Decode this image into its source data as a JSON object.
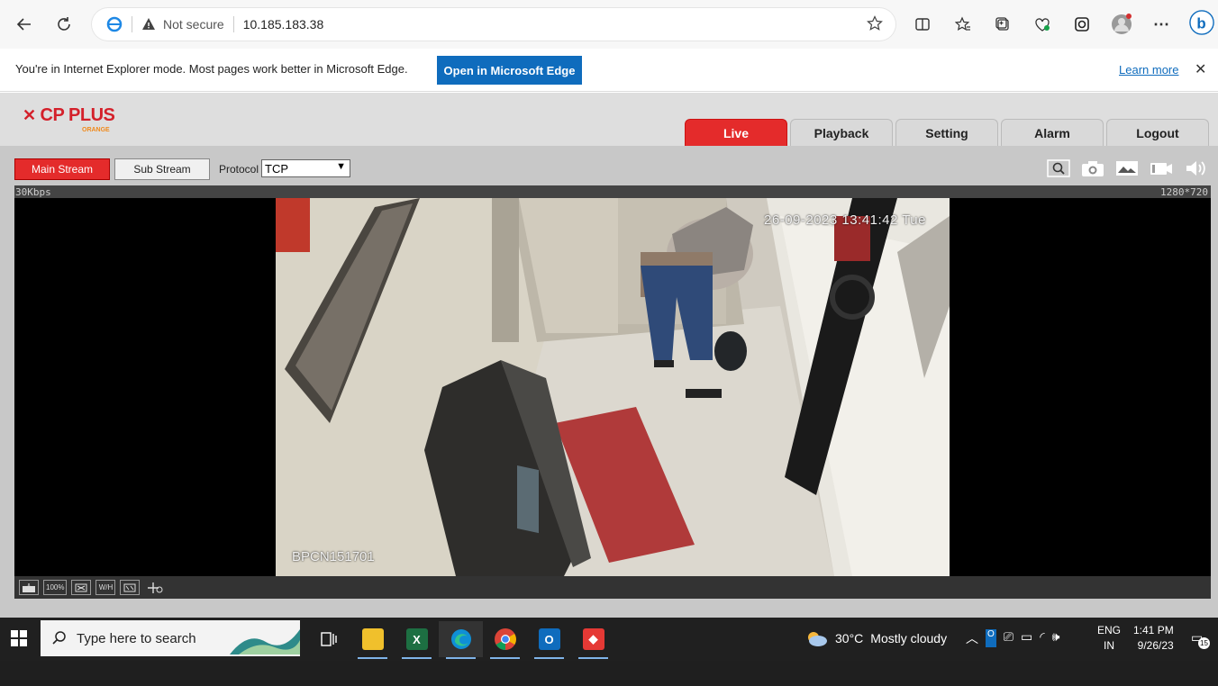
{
  "browser": {
    "security_label": "Not secure",
    "url": "10.185.183.38"
  },
  "ie_bar": {
    "message": "You're in Internet Explorer mode. Most pages work better in Microsoft Edge.",
    "open_button": "Open in Microsoft Edge",
    "learn_more": "Learn more"
  },
  "app": {
    "logo_text": "CP PLUS",
    "logo_sub": "ORANGE",
    "tabs": [
      {
        "label": "Live",
        "active": true
      },
      {
        "label": "Playback",
        "active": false
      },
      {
        "label": "Setting",
        "active": false
      },
      {
        "label": "Alarm",
        "active": false
      },
      {
        "label": "Logout",
        "active": false
      }
    ],
    "stream": {
      "main_label": "Main Stream",
      "sub_label": "Sub Stream",
      "protocol_label": "Protocol",
      "protocol_value": "TCP"
    },
    "video": {
      "bitrate": "30Kbps",
      "resolution": "1280*720",
      "timestamp": "26-09-2023 13:41:42 Tue",
      "camera_name": "BPCN151701"
    },
    "bottom_icons": [
      "fullscreen",
      "100%",
      "fit",
      "W/H",
      "ratio",
      "zoom"
    ],
    "bottom_zoom_label": "100%",
    "bottom_wh_label": "W/H",
    "top_icons": [
      "search-icon",
      "camera-icon",
      "image-icon",
      "record-icon",
      "volume-icon"
    ]
  },
  "taskbar": {
    "search_placeholder": "Type here to search",
    "weather_temp": "30°C",
    "weather_text": "Mostly cloudy",
    "lang_top": "ENG",
    "lang_bottom": "IN",
    "time": "1:41 PM",
    "date": "9/26/23",
    "notif_count": "15"
  }
}
